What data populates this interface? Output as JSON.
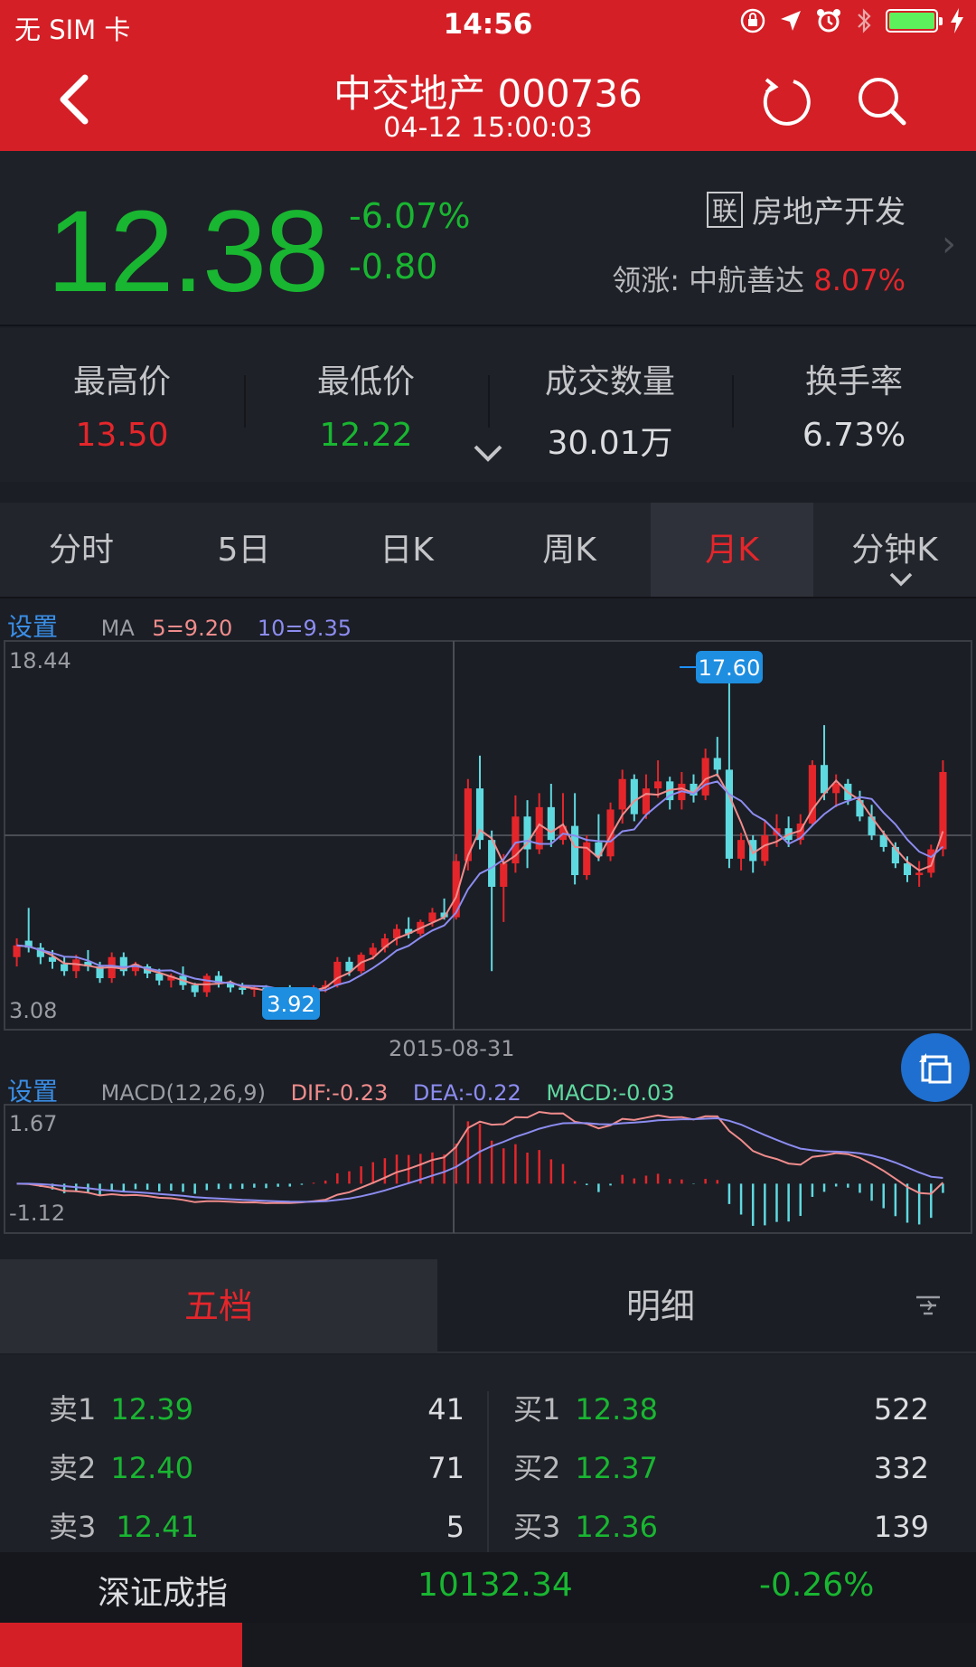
{
  "status": {
    "carrier": "无 SIM 卡",
    "time": "14:56"
  },
  "header": {
    "title": "中交地产 000736",
    "subtitle": "04-12 15:00:03"
  },
  "quote": {
    "price": "12.38",
    "change_pct": "-6.07%",
    "change": "-0.80",
    "sector_icon_char": "联",
    "sector": "房地产开发",
    "leader_label": "领涨:",
    "leader_name": "中航善达",
    "leader_pct": "8.07%"
  },
  "stats": [
    {
      "label": "最高价",
      "value": "13.50",
      "color": "#e4262b"
    },
    {
      "label": "最低价",
      "value": "12.22",
      "color": "#19b631"
    },
    {
      "label": "成交数量",
      "value": "30.01万",
      "color": "#dcdde0"
    },
    {
      "label": "换手率",
      "value": "6.73%",
      "color": "#dcdde0"
    }
  ],
  "tabs": [
    "分时",
    "5日",
    "日K",
    "周K",
    "月K",
    "分钟K"
  ],
  "active_tab": "月K",
  "kline": {
    "settings_label": "设置",
    "ma_label": "MA",
    "ma5": "5=9.20",
    "ma10": "10=9.35",
    "y_max_label": "18.44",
    "y_min_label": "3.08",
    "y_range": [
      3.08,
      18.44
    ],
    "high_marker": "17.60",
    "low_marker": "3.92",
    "date_label": "2015-08-31"
  },
  "macd": {
    "settings_label": "设置",
    "title": "MACD(12,26,9)",
    "dif": "DIF:-0.23",
    "dea": "DEA:-0.22",
    "macd": "MACD:-0.03",
    "y_max_label": "1.67",
    "y_min_label": "-1.12",
    "y_range": [
      -1.12,
      1.67
    ]
  },
  "orderbook": {
    "tab1": "五档",
    "tab2": "明细",
    "sell": [
      {
        "label": "卖1",
        "price": "12.39",
        "qty": "41"
      },
      {
        "label": "卖2",
        "price": "12.40",
        "qty": "71"
      },
      {
        "label": "卖3",
        "price": "12.41",
        "qty": "5"
      }
    ],
    "buy": [
      {
        "label": "买1",
        "price": "12.38",
        "qty": "522"
      },
      {
        "label": "买2",
        "price": "12.37",
        "qty": "332"
      },
      {
        "label": "买3",
        "price": "12.36",
        "qty": "139"
      }
    ]
  },
  "index": {
    "name": "深证成指",
    "value": "10132.34",
    "change": "-0.26%"
  },
  "colors": {
    "up": "#e4262b",
    "down": "#19b631",
    "header": "#d41f26",
    "ma5": "#f08c8c",
    "ma10": "#8c8cf0",
    "macd_down": "#5fd9e0"
  },
  "chart_data": {
    "type": "candlestick",
    "y_range": [
      3.08,
      18.44
    ],
    "ohlc": [
      [
        5.6,
        6.4,
        5.2,
        6.1
      ],
      [
        6.3,
        7.7,
        5.8,
        6.0
      ],
      [
        6.0,
        6.2,
        5.3,
        5.6
      ],
      [
        5.6,
        5.9,
        5.1,
        5.4
      ],
      [
        5.3,
        5.6,
        4.8,
        5.0
      ],
      [
        5.0,
        5.7,
        4.7,
        5.5
      ],
      [
        5.4,
        5.9,
        5.0,
        5.2
      ],
      [
        5.2,
        5.4,
        4.5,
        4.7
      ],
      [
        4.7,
        5.8,
        4.5,
        5.6
      ],
      [
        5.6,
        5.8,
        4.8,
        5.0
      ],
      [
        5.0,
        5.4,
        4.8,
        5.3
      ],
      [
        5.2,
        5.3,
        4.7,
        4.9
      ],
      [
        4.9,
        5.1,
        4.4,
        4.6
      ],
      [
        4.6,
        4.9,
        4.3,
        4.8
      ],
      [
        4.8,
        5.2,
        4.2,
        4.4
      ],
      [
        4.4,
        4.5,
        3.9,
        4.1
      ],
      [
        4.1,
        4.9,
        3.9,
        4.8
      ],
      [
        4.8,
        5.0,
        4.3,
        4.5
      ],
      [
        4.5,
        4.6,
        4.1,
        4.3
      ],
      [
        4.3,
        4.5,
        4.0,
        4.2
      ],
      [
        4.2,
        4.4,
        3.9,
        4.3
      ],
      [
        4.3,
        4.4,
        3.9,
        4.0
      ],
      [
        4.0,
        4.3,
        3.8,
        4.2
      ],
      [
        4.2,
        4.4,
        3.92,
        4.0
      ],
      [
        4.0,
        4.3,
        3.9,
        4.2
      ],
      [
        4.2,
        4.4,
        4.0,
        4.3
      ],
      [
        4.3,
        4.6,
        4.1,
        4.4
      ],
      [
        4.4,
        5.6,
        4.3,
        5.4
      ],
      [
        5.4,
        5.6,
        4.8,
        5.0
      ],
      [
        5.0,
        5.8,
        4.9,
        5.7
      ],
      [
        5.7,
        6.2,
        5.5,
        6.0
      ],
      [
        6.0,
        6.6,
        5.8,
        6.4
      ],
      [
        6.4,
        7.0,
        6.1,
        6.8
      ],
      [
        6.8,
        7.3,
        6.4,
        6.6
      ],
      [
        6.6,
        7.2,
        6.5,
        7.1
      ],
      [
        7.1,
        7.7,
        6.9,
        7.5
      ],
      [
        7.5,
        8.1,
        7.2,
        7.3
      ],
      [
        7.3,
        10.0,
        7.2,
        9.7
      ],
      [
        9.7,
        13.2,
        9.3,
        12.8
      ],
      [
        12.8,
        14.2,
        10.2,
        10.6
      ],
      [
        10.6,
        11.0,
        5.0,
        8.6
      ],
      [
        8.6,
        10.0,
        7.1,
        9.6
      ],
      [
        9.6,
        12.5,
        9.2,
        11.6
      ],
      [
        11.6,
        12.3,
        9.4,
        10.2
      ],
      [
        10.2,
        12.6,
        10.0,
        12.0
      ],
      [
        12.0,
        13.0,
        10.3,
        10.6
      ],
      [
        10.6,
        12.6,
        10.4,
        11.2
      ],
      [
        11.2,
        12.6,
        8.7,
        9.1
      ],
      [
        9.1,
        10.8,
        8.9,
        10.5
      ],
      [
        10.5,
        11.7,
        9.7,
        9.9
      ],
      [
        9.9,
        12.2,
        9.7,
        11.9
      ],
      [
        11.9,
        13.6,
        11.3,
        13.2
      ],
      [
        13.2,
        13.4,
        11.4,
        11.7
      ],
      [
        11.7,
        13.4,
        11.5,
        12.8
      ],
      [
        12.8,
        14.0,
        12.4,
        13.1
      ],
      [
        13.1,
        13.3,
        11.9,
        12.3
      ],
      [
        12.3,
        13.5,
        11.9,
        13.0
      ],
      [
        13.0,
        13.4,
        12.2,
        12.5
      ],
      [
        12.5,
        14.5,
        12.3,
        14.1
      ],
      [
        14.1,
        15.0,
        13.3,
        13.6
      ],
      [
        13.6,
        17.6,
        9.4,
        9.8
      ],
      [
        9.8,
        10.9,
        9.3,
        10.6
      ],
      [
        10.6,
        10.8,
        9.2,
        9.7
      ],
      [
        9.7,
        11.4,
        9.5,
        10.8
      ],
      [
        10.8,
        11.7,
        10.3,
        11.1
      ],
      [
        11.1,
        11.6,
        10.3,
        10.6
      ],
      [
        10.6,
        11.7,
        10.4,
        11.3
      ],
      [
        11.3,
        14.0,
        11.2,
        13.8
      ],
      [
        13.8,
        15.5,
        12.3,
        12.6
      ],
      [
        12.6,
        13.4,
        12.0,
        13.0
      ],
      [
        13.0,
        13.2,
        12.1,
        12.3
      ],
      [
        12.3,
        12.7,
        11.4,
        11.6
      ],
      [
        11.6,
        12.1,
        10.6,
        10.8
      ],
      [
        10.8,
        11.0,
        10.1,
        10.3
      ],
      [
        10.3,
        10.5,
        9.4,
        9.6
      ],
      [
        9.6,
        9.9,
        8.8,
        9.1
      ],
      [
        9.1,
        9.7,
        8.6,
        9.2
      ],
      [
        9.2,
        10.4,
        9.0,
        10.2
      ],
      [
        10.2,
        14.0,
        9.9,
        13.5
      ]
    ]
  }
}
